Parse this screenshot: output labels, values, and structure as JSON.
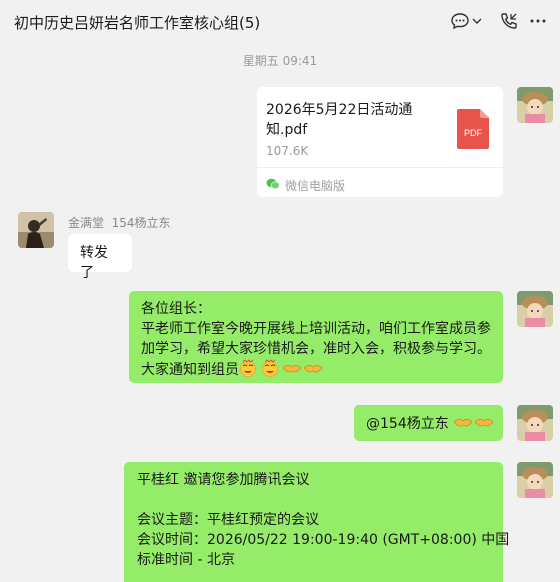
{
  "header": {
    "title": "初中历史吕妍岩名师工作室核心组(5)"
  },
  "timestamp": "星期五 09:41",
  "messages": {
    "file": {
      "name": "2026年5月22日活动通知.pdf",
      "size": "107.6K",
      "source": "微信电脑版",
      "type_label": "PDF"
    },
    "forward": {
      "sender_name": "金满堂",
      "sender_tag": "154杨立东",
      "text": "转发了"
    },
    "notice": {
      "line1": "各位组长：",
      "line2": "平老师工作室今晚开展线上培训活动，咱们工作室成员参",
      "line3": "加学习，希望大家珍惜机会，准时入会，积极参与学习。",
      "line4": "大家通知到组员"
    },
    "mention": {
      "text": "@154杨立东"
    },
    "meeting": {
      "invite": "平桂红 邀请您参加腾讯会议",
      "topic_label": "会议主题：",
      "topic": "平桂红预定的会议",
      "time_label": "会议时间：",
      "time_line1": "2026/05/22 19:00-19:40 (GMT+08:00) 中国",
      "time_line2": "标准时间 - 北京"
    }
  },
  "colors": {
    "green_bubble": "#95ec69",
    "pdf_red": "#e8554d",
    "background": "#f1f1f1"
  }
}
